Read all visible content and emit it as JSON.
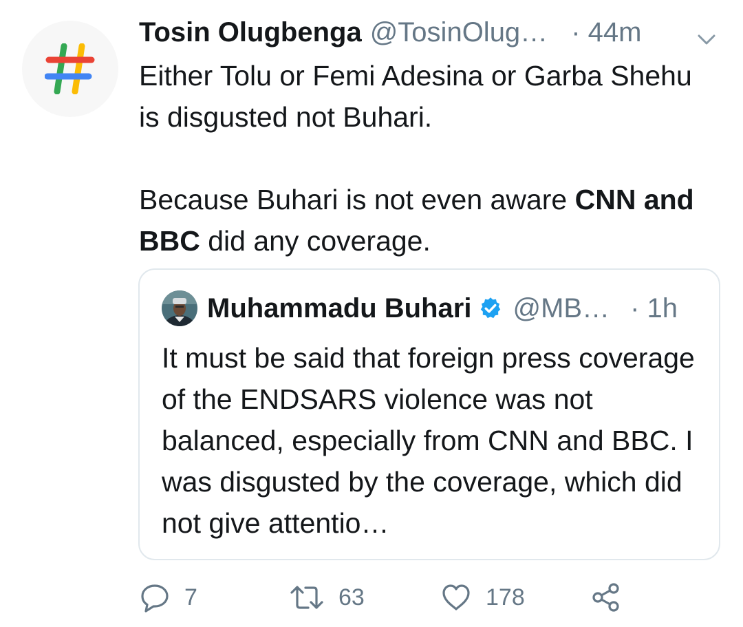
{
  "tweet": {
    "author_name": "Tosin Olugbenga",
    "author_handle": "@TosinOlug…",
    "time": "· 44m",
    "body_p1": "Either Tolu or Femi Adesina or Garba Shehu is disgusted not Buhari.",
    "body_p2_pre": "Because Buhari is not even aware ",
    "body_p2_bold": "CNN and BBC",
    "body_p2_post": " did any coverage."
  },
  "quoted": {
    "author_name": "Muhammadu Buhari",
    "author_handle": "@MB…",
    "time": "· 1h",
    "verified": true,
    "body": "It must be said that foreign press coverage of the ENDSARS violence was not balanced, especially from CNN and BBC. I was disgusted by the coverage, which did not give attentio…"
  },
  "actions": {
    "reply_count": "7",
    "retweet_count": "63",
    "like_count": "178"
  },
  "colors": {
    "text_primary": "#14171a",
    "text_secondary": "#657786",
    "verified_blue": "#1da1f2",
    "card_border": "#e1e8ed"
  },
  "icons": [
    "hashtag-logo-icon",
    "chevron-down-icon",
    "verified-badge-icon",
    "reply-icon",
    "retweet-icon",
    "like-icon",
    "share-icon"
  ]
}
